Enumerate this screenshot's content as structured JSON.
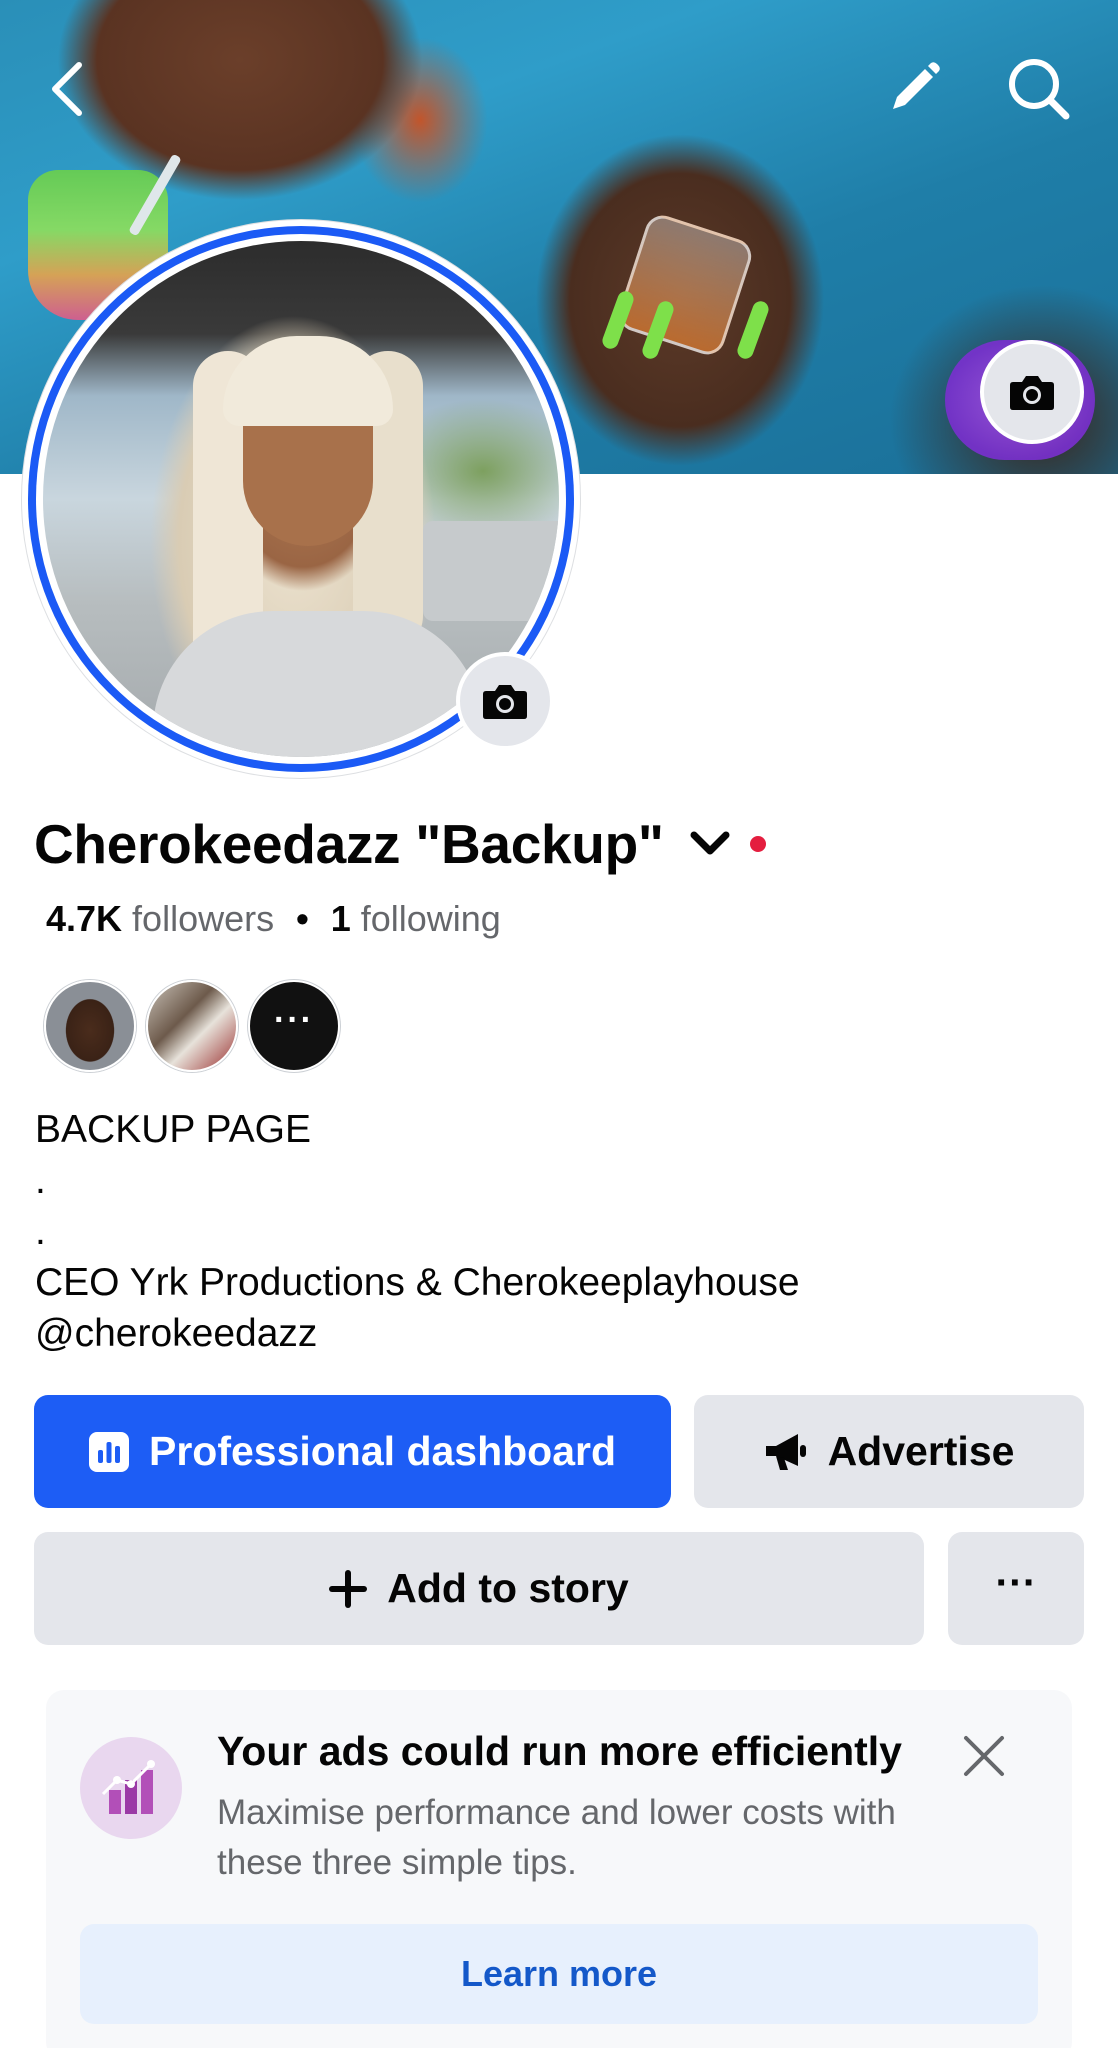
{
  "header": {
    "back_icon": "chevron-left-icon",
    "edit_icon": "pencil-icon",
    "search_icon": "search-icon",
    "cover_camera_icon": "camera-icon"
  },
  "profile": {
    "avatar_camera_icon": "camera-icon",
    "name": "Cherokeedazz \"Backup\"",
    "name_dropdown_icon": "chevron-down-icon",
    "status_color": "#e41e3f",
    "followers_count": "4.7K",
    "followers_label": "followers",
    "separator": "•",
    "following_count": "1",
    "following_label": "following",
    "friends_more_label": "···",
    "bio": "BACKUP PAGE\n.\n.\nCEO Yrk Productions & Cherokeeplayhouse\n@cherokeedazz"
  },
  "actions": {
    "professional_dashboard": "Professional dashboard",
    "advertise": "Advertise",
    "add_to_story": "Add to story",
    "more": "···"
  },
  "ad_card": {
    "title": "Your ads could run more efficiently",
    "text": "Maximise performance and lower costs with these three simple tips.",
    "learn_more": "Learn more"
  },
  "colors": {
    "primary_blue": "#1d5df5",
    "secondary_gray": "#e4e6eb",
    "link_blue": "#1458c9"
  }
}
